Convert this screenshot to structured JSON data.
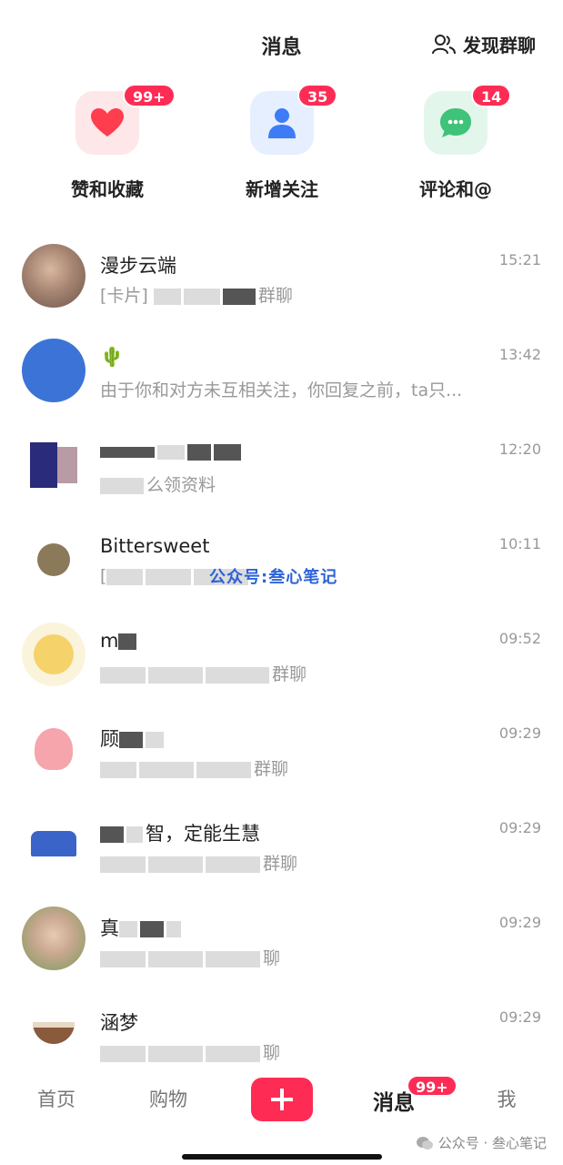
{
  "header": {
    "title": "消息",
    "discover_label": "发现群聊"
  },
  "quick": [
    {
      "label": "赞和收藏",
      "badge": "99+",
      "icon": "heart-icon",
      "bg": "#fde7e9",
      "color": "#fe3e4f"
    },
    {
      "label": "新增关注",
      "badge": "35",
      "icon": "person-icon",
      "bg": "#e5efff",
      "color": "#3d7cf6"
    },
    {
      "label": "评论和@",
      "badge": "14",
      "icon": "chat-bubble-icon",
      "bg": "#e3f6ec",
      "color": "#3fc27a"
    }
  ],
  "conversations": [
    {
      "name": "漫步云端",
      "preview": "[卡片]",
      "preview_tail": "群聊",
      "time": "15:21"
    },
    {
      "name": "🌵",
      "preview": "由于你和对方未互相关注，你回复之前，ta只...",
      "time": "13:42"
    },
    {
      "name": "",
      "preview": "么领资料",
      "time": "12:20"
    },
    {
      "name": "Bittersweet",
      "preview": "[",
      "time": "10:11"
    },
    {
      "name": "m",
      "preview": "",
      "preview_tail": "群聊",
      "time": "09:52"
    },
    {
      "name": "顾",
      "preview": "",
      "preview_tail": "群聊",
      "time": "09:29"
    },
    {
      "name": "智，定能生慧",
      "preview": "",
      "preview_tail": "群聊",
      "time": "09:29"
    },
    {
      "name": "真",
      "preview": "",
      "preview_tail": "聊",
      "time": "09:29"
    },
    {
      "name": "涵梦",
      "preview": "",
      "preview_tail": "聊",
      "time": "09:29"
    }
  ],
  "watermark": "公众号:叁心笔记",
  "tabbar": {
    "home": "首页",
    "shop": "购物",
    "messages": "消息",
    "messages_badge": "99+",
    "me": "我"
  },
  "footer_mark": "公众号 · 叁心笔记",
  "colors": {
    "accent": "#fe2c55"
  }
}
